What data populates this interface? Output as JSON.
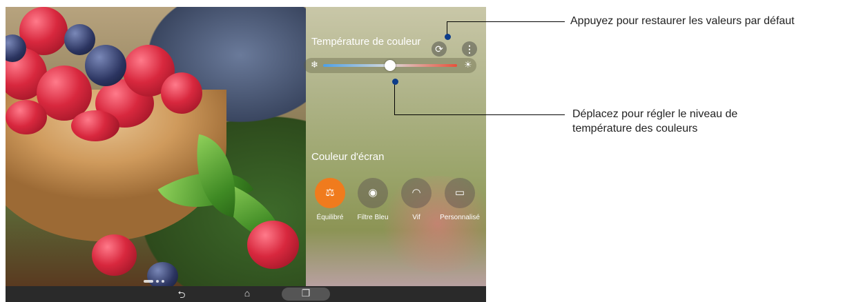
{
  "panel": {
    "color_temperature_title": "Température de couleur",
    "restore_icon": "refresh-icon",
    "more_icon": "more-vert-icon",
    "slider": {
      "cold_icon": "snowflake-icon",
      "warm_icon": "sun-icon",
      "value_fraction": 0.5
    },
    "screen_color_title": "Couleur d'écran",
    "modes": [
      {
        "label": "Équilibré",
        "icon": "balance-icon",
        "active": true
      },
      {
        "label": "Filtre Bleu",
        "icon": "eye-shield-icon",
        "active": false
      },
      {
        "label": "Vif",
        "icon": "rainbow-icon",
        "active": false
      },
      {
        "label": "Personnalisé",
        "icon": "custom-screen-icon",
        "active": false
      }
    ],
    "accent_color": "#f07b1d"
  },
  "navbar": {
    "back_icon": "back-icon",
    "home_icon": "home-icon",
    "recents_icon": "recents-icon"
  },
  "page_indicator": {
    "count": 3,
    "active": 0
  },
  "callouts": {
    "restore": "Appuyez pour restaurer les valeurs par défaut",
    "slider_line1": "Déplacez pour régler le niveau de",
    "slider_line2": "température des couleurs"
  }
}
